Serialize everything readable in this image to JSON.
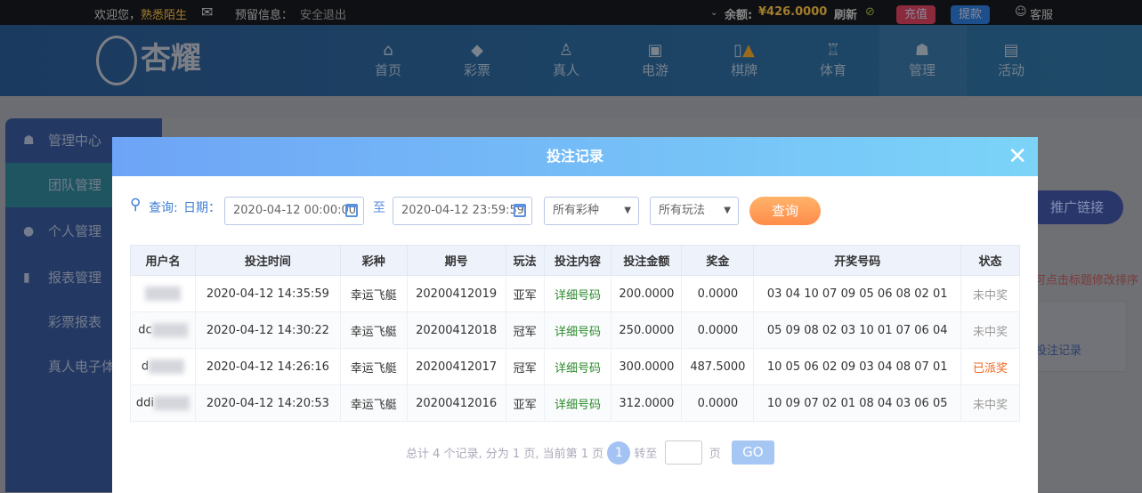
{
  "topbar": {
    "welcome": "欢迎您，",
    "username": "熟悉陌生",
    "reserved": "预留信息：",
    "logout": "安全退出",
    "balance_label": "余额:",
    "balance": "¥426.0000",
    "refresh": "刷新",
    "deposit": "充值",
    "withdraw": "提款",
    "service": "客服"
  },
  "brand": {
    "logo": "杏耀"
  },
  "nav": [
    {
      "label": "首页",
      "icon": "home-icon"
    },
    {
      "label": "彩票",
      "icon": "lottery-icon"
    },
    {
      "label": "真人",
      "icon": "live-icon"
    },
    {
      "label": "电游",
      "icon": "slot-icon"
    },
    {
      "label": "棋牌",
      "icon": "cards-icon"
    },
    {
      "label": "体育",
      "icon": "trophy-icon"
    },
    {
      "label": "管理",
      "icon": "users-icon"
    },
    {
      "label": "活动",
      "icon": "gift-icon"
    }
  ],
  "sidebar": [
    {
      "label": "管理中心"
    },
    {
      "label": "团队管理"
    },
    {
      "label": "个人管理"
    },
    {
      "label": "报表管理"
    },
    {
      "label": "彩票报表"
    },
    {
      "label": "真人电子体"
    }
  ],
  "content": {
    "promo": "推广链接",
    "hint": "可点击标题修改排序",
    "panel_link": "投注记录"
  },
  "modal": {
    "title": "投注记录",
    "query_label": "查询:",
    "date_label": "日期：",
    "start": "2020-04-12 00:00:00",
    "to": "至",
    "end": "2020-04-12 23:59:59",
    "lottery_select": "所有彩种",
    "play_select": "所有玩法",
    "query_btn": "查询",
    "columns": [
      "用户名",
      "投注时间",
      "彩种",
      "期号",
      "玩法",
      "投注内容",
      "投注金额",
      "奖金",
      "开奖号码",
      "状态"
    ],
    "rows": [
      [
        "",
        "2020-04-12 14:35:59",
        "幸运飞艇",
        "20200412019",
        "亚军",
        "详细号码",
        "200.0000",
        "0.0000",
        "03 04 10 07 09 05 06 08 02 01",
        "未中奖"
      ],
      [
        "dc",
        "2020-04-12 14:30:22",
        "幸运飞艇",
        "20200412018",
        "冠军",
        "详细号码",
        "250.0000",
        "0.0000",
        "05 09 08 02 03 10 01 07 06 04",
        "未中奖"
      ],
      [
        "d",
        "2020-04-12 14:26:16",
        "幸运飞艇",
        "20200412017",
        "冠军",
        "详细号码",
        "300.0000",
        "487.5000",
        "10 05 06 02 09 03 04 08 07 01",
        "已派奖"
      ],
      [
        "ddi",
        "2020-04-12 14:20:53",
        "幸运飞艇",
        "20200412016",
        "亚军",
        "详细号码",
        "312.0000",
        "0.0000",
        "10 09 07 02 01 08 04 03 06 05",
        "未中奖"
      ]
    ],
    "pager": {
      "summary": "总计 4 个记录, 分为 1 页, 当前第 1 页",
      "current": "1",
      "goto": "转至",
      "page": "页",
      "go": "GO"
    }
  }
}
